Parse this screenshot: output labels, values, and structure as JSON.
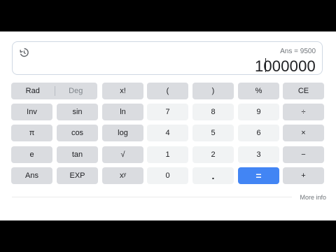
{
  "display": {
    "ans_text": "Ans = 9500",
    "result": "1000000",
    "history_icon": "history-icon"
  },
  "keys": {
    "rad": "Rad",
    "deg": "Deg",
    "fact": "x!",
    "lparen": "(",
    "rparen": ")",
    "percent": "%",
    "ce": "CE",
    "inv": "Inv",
    "sin": "sin",
    "ln": "ln",
    "seven": "7",
    "eight": "8",
    "nine": "9",
    "divide": "÷",
    "pi": "π",
    "cos": "cos",
    "log": "log",
    "four": "4",
    "five": "5",
    "six": "6",
    "multiply": "×",
    "e": "e",
    "tan": "tan",
    "sqrt": "√",
    "one": "1",
    "two": "2",
    "three": "3",
    "minus": "−",
    "ans": "Ans",
    "exp": "EXP",
    "power": "xʸ",
    "zero": "0",
    "dot": ".",
    "equals": "=",
    "plus": "+"
  },
  "footer": {
    "more_info": "More info"
  },
  "colors": {
    "func_key": "#dadce0",
    "num_key": "#f1f3f4",
    "equals_key": "#4285f4"
  }
}
